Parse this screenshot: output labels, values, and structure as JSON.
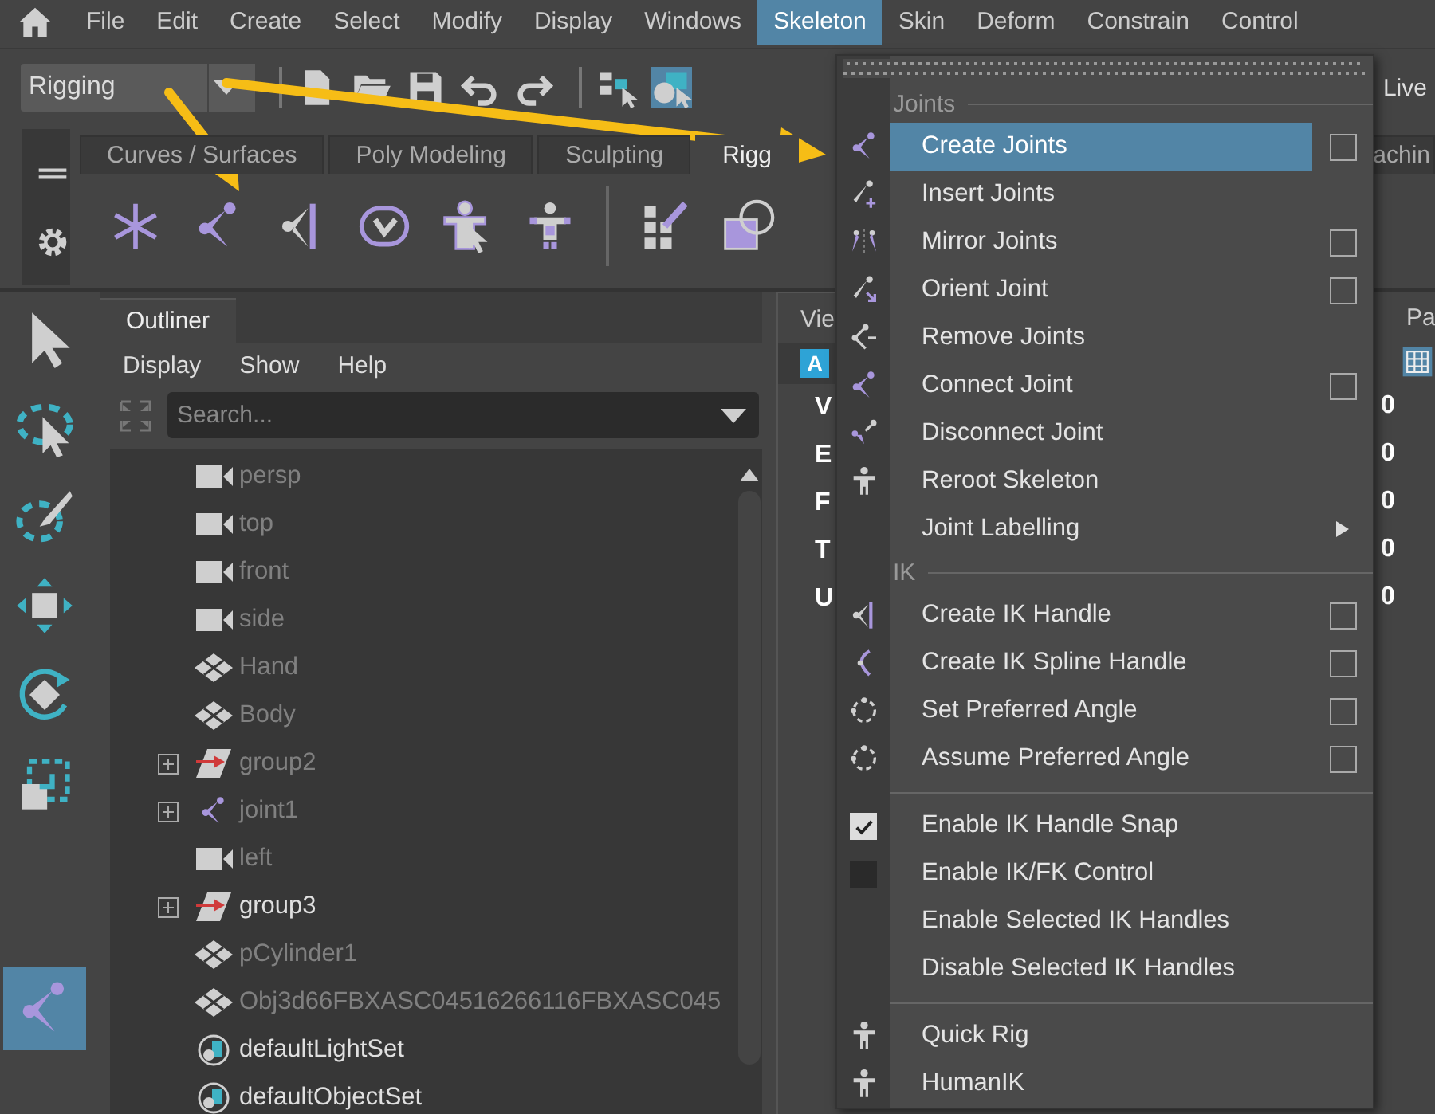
{
  "menubar": {
    "items": [
      {
        "label": "File",
        "selected": false
      },
      {
        "label": "Edit",
        "selected": false
      },
      {
        "label": "Create",
        "selected": false
      },
      {
        "label": "Select",
        "selected": false
      },
      {
        "label": "Modify",
        "selected": false
      },
      {
        "label": "Display",
        "selected": false
      },
      {
        "label": "Windows",
        "selected": false
      },
      {
        "label": "Skeleton",
        "selected": true
      },
      {
        "label": "Skin",
        "selected": false
      },
      {
        "label": "Deform",
        "selected": false
      },
      {
        "label": "Constrain",
        "selected": false
      },
      {
        "label": "Control",
        "selected": false
      }
    ]
  },
  "status_line": {
    "menu_set": "Rigging",
    "live_label": "Live"
  },
  "shelf": {
    "tabs": [
      {
        "label": "Curves / Surfaces",
        "selected": false
      },
      {
        "label": "Poly Modeling",
        "selected": false
      },
      {
        "label": "Sculpting",
        "selected": false
      },
      {
        "label": "Rigg",
        "selected": true
      },
      {
        "label": "achin",
        "selected": false
      }
    ]
  },
  "toolbox": {
    "tools": [
      {
        "selected": false
      },
      {
        "selected": false
      },
      {
        "selected": false
      },
      {
        "selected": false
      },
      {
        "selected": false
      },
      {
        "selected": false
      },
      {
        "selected": true
      }
    ]
  },
  "outliner": {
    "title": "Outliner",
    "menu": [
      "Display",
      "Show",
      "Help"
    ],
    "search": {
      "placeholder": "Search..."
    },
    "rows": [
      {
        "label": "persp",
        "kind": "camera",
        "expander": false,
        "dimmed": true
      },
      {
        "label": "top",
        "kind": "camera",
        "expander": false,
        "dimmed": true
      },
      {
        "label": "front",
        "kind": "camera",
        "expander": false,
        "dimmed": true
      },
      {
        "label": "side",
        "kind": "camera",
        "expander": false,
        "dimmed": true
      },
      {
        "label": "Hand",
        "kind": "mesh",
        "expander": false,
        "dimmed": true
      },
      {
        "label": "Body",
        "kind": "mesh",
        "expander": false,
        "dimmed": true
      },
      {
        "label": "group2",
        "kind": "group",
        "expander": true,
        "dimmed": true
      },
      {
        "label": "joint1",
        "kind": "joint",
        "expander": true,
        "dimmed": true
      },
      {
        "label": "left",
        "kind": "camera",
        "expander": false,
        "dimmed": true
      },
      {
        "label": "group3",
        "kind": "group",
        "expander": true,
        "dimmed": false
      },
      {
        "label": "pCylinder1",
        "kind": "mesh",
        "expander": false,
        "dimmed": true
      },
      {
        "label": "Obj3d66FBXASC04516266116FBXASC045",
        "kind": "mesh",
        "expander": false,
        "dimmed": true
      },
      {
        "label": "defaultLightSet",
        "kind": "set",
        "expander": false,
        "dimmed": false
      },
      {
        "label": "defaultObjectSet",
        "kind": "set",
        "expander": false,
        "dimmed": false
      }
    ]
  },
  "view_panel": {
    "tab": "Vie",
    "badge": "A",
    "rows": [
      "V",
      "E",
      "F",
      "T",
      "U"
    ]
  },
  "side_panel": {
    "tab": "Pa",
    "values": [
      "0",
      "0",
      "0",
      "0",
      "0"
    ]
  },
  "skeleton_menu": {
    "items": [
      {
        "kind": "header",
        "label": "Joints"
      },
      {
        "kind": "item",
        "label": "Create Joints",
        "option_box": true,
        "submenu": false,
        "selected": true
      },
      {
        "kind": "item",
        "label": "Insert Joints",
        "option_box": false,
        "submenu": false,
        "selected": false
      },
      {
        "kind": "item",
        "label": "Mirror Joints",
        "option_box": true,
        "submenu": false,
        "selected": false
      },
      {
        "kind": "item",
        "label": "Orient Joint",
        "option_box": true,
        "submenu": false,
        "selected": false
      },
      {
        "kind": "item",
        "label": "Remove Joints",
        "option_box": false,
        "submenu": false,
        "selected": false
      },
      {
        "kind": "item",
        "label": "Connect Joint",
        "option_box": true,
        "submenu": false,
        "selected": false
      },
      {
        "kind": "item",
        "label": "Disconnect Joint",
        "option_box": false,
        "submenu": false,
        "selected": false
      },
      {
        "kind": "item",
        "label": "Reroot Skeleton",
        "option_box": false,
        "submenu": false,
        "selected": false
      },
      {
        "kind": "item",
        "label": "Joint Labelling",
        "option_box": false,
        "submenu": true,
        "selected": false
      },
      {
        "kind": "header",
        "label": "IK"
      },
      {
        "kind": "item",
        "label": "Create IK Handle",
        "option_box": true,
        "submenu": false,
        "selected": false
      },
      {
        "kind": "item",
        "label": "Create IK Spline Handle",
        "option_box": true,
        "submenu": false,
        "selected": false
      },
      {
        "kind": "item",
        "label": "Set Preferred Angle",
        "option_box": true,
        "submenu": false,
        "selected": false
      },
      {
        "kind": "item",
        "label": "Assume Preferred Angle",
        "option_box": true,
        "submenu": false,
        "selected": false
      },
      {
        "kind": "divider"
      },
      {
        "kind": "check",
        "label": "Enable IK Handle Snap",
        "checked": true,
        "selected": false
      },
      {
        "kind": "check",
        "label": "Enable IK/FK Control",
        "checked": false,
        "selected": false
      },
      {
        "kind": "item",
        "label": "Enable Selected IK Handles",
        "option_box": false,
        "submenu": false,
        "selected": false
      },
      {
        "kind": "item",
        "label": "Disable Selected IK Handles",
        "option_box": false,
        "submenu": false,
        "selected": false
      },
      {
        "kind": "divider"
      },
      {
        "kind": "item",
        "label": "Quick Rig",
        "option_box": false,
        "submenu": false,
        "selected": false
      },
      {
        "kind": "item",
        "label": "HumanIK",
        "option_box": false,
        "submenu": false,
        "selected": false
      }
    ]
  }
}
